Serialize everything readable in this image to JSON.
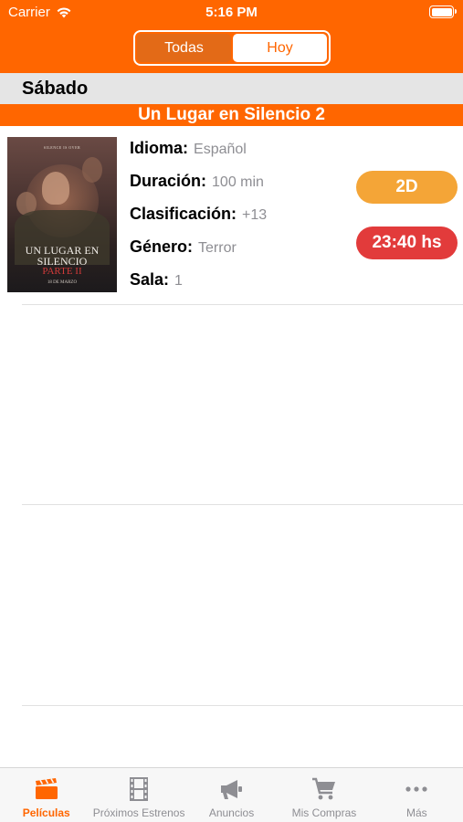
{
  "status_bar": {
    "carrier": "Carrier",
    "time": "5:16 PM"
  },
  "segmented": {
    "options": [
      "Todas",
      "Hoy"
    ],
    "selected": "Hoy"
  },
  "day": {
    "label": "Sábado"
  },
  "movie": {
    "title": "Un Lugar en Silencio 2",
    "poster_text": {
      "tagline": "SILENCE IS OVER",
      "line1": "UN LUGAR EN",
      "line2": "SILENCIO",
      "line3": "PARTE II",
      "date": "18 DE MARZO"
    },
    "details": [
      {
        "label": "Idioma:",
        "value": "Español"
      },
      {
        "label": "Duración:",
        "value": "100 min"
      },
      {
        "label": "Clasificación:",
        "value": "+13"
      },
      {
        "label": "Género:",
        "value": "Terror"
      },
      {
        "label": "Sala:",
        "value": "1"
      }
    ],
    "format": "2D",
    "showtime": "23:40 hs"
  },
  "tabs": [
    {
      "label": "Películas",
      "icon": "clapperboard-icon",
      "active": true
    },
    {
      "label": "Próximos Estrenos",
      "icon": "film-strip-icon",
      "active": false
    },
    {
      "label": "Anuncios",
      "icon": "megaphone-icon",
      "active": false
    },
    {
      "label": "Mis Compras",
      "icon": "cart-icon",
      "active": false
    },
    {
      "label": "Más",
      "icon": "more-dots-icon",
      "active": false
    }
  ],
  "colors": {
    "brand": "#ff6600",
    "format_badge": "#f4a537",
    "time_badge": "#e23b3b",
    "inactive": "#8e8e93"
  }
}
